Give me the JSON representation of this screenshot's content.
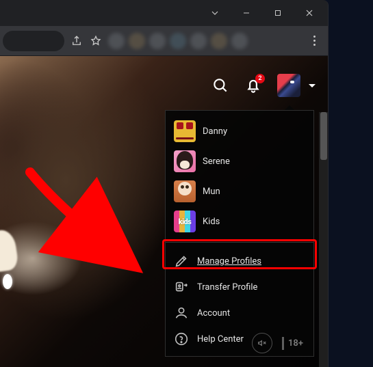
{
  "notification_count": "2",
  "profiles": [
    {
      "name": "Danny"
    },
    {
      "name": "Serene"
    },
    {
      "name": "Mun"
    },
    {
      "name": "Kids"
    }
  ],
  "menu": {
    "manage_profiles": "Manage Profiles",
    "transfer_profile": "Transfer Profile",
    "account": "Account",
    "help_center": "Help Center"
  },
  "kids_avatar_text": "kids",
  "age_rating": "18+"
}
